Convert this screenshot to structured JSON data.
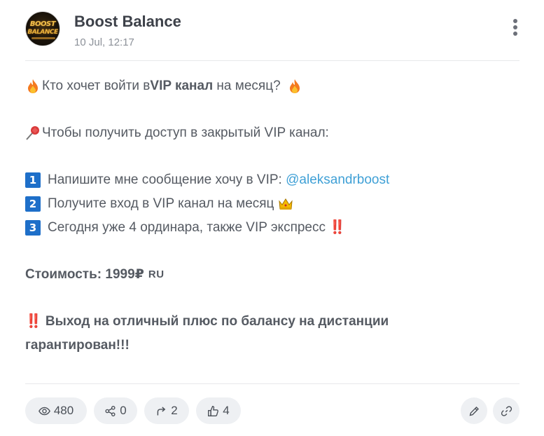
{
  "post": {
    "channel_name": "Boost Balance",
    "date": "10 Jul, 12:17",
    "avatar_text_line1": "BOOST",
    "avatar_text_line2": "BALANCE"
  },
  "body": {
    "line1_pre": "Кто хочет войти в ",
    "line1_bold": "VIP канал",
    "line1_post": " на месяц? ",
    "line2": "Чтобы получить доступ в закрытый VIP канал:",
    "step1_badge": "1",
    "step1_text": "Напишите мне сообщение хочу в VIP: ",
    "step1_mention": "@aleksandrboost",
    "step2_badge": "2",
    "step2_text": "Получите вход в VIP канал на месяц ",
    "step3_badge": "3",
    "step3_text": "Сегодня уже 4 ординара, также VIP экспресс ‼️",
    "price": "Стоимость: 1999₽",
    "price_flag": "RU",
    "guarantee_line1": "‼️ Выход на отличный плюс по балансу на дистанции",
    "guarantee_line2": "гарантирован!!!"
  },
  "stats": {
    "views": "480",
    "shares": "0",
    "forwards": "2",
    "likes": "4"
  },
  "icons": {
    "views": "eye-icon",
    "shares": "share-icon",
    "forwards": "forward-arrow-icon",
    "likes": "thumbs-up-icon",
    "edit": "pencil-icon",
    "link": "link-icon",
    "more": "more-vertical-icon"
  },
  "colors": {
    "mention": "#3fa0d6",
    "pill_bg": "#eef0f3",
    "badge_blue": "#1e6fc9"
  }
}
